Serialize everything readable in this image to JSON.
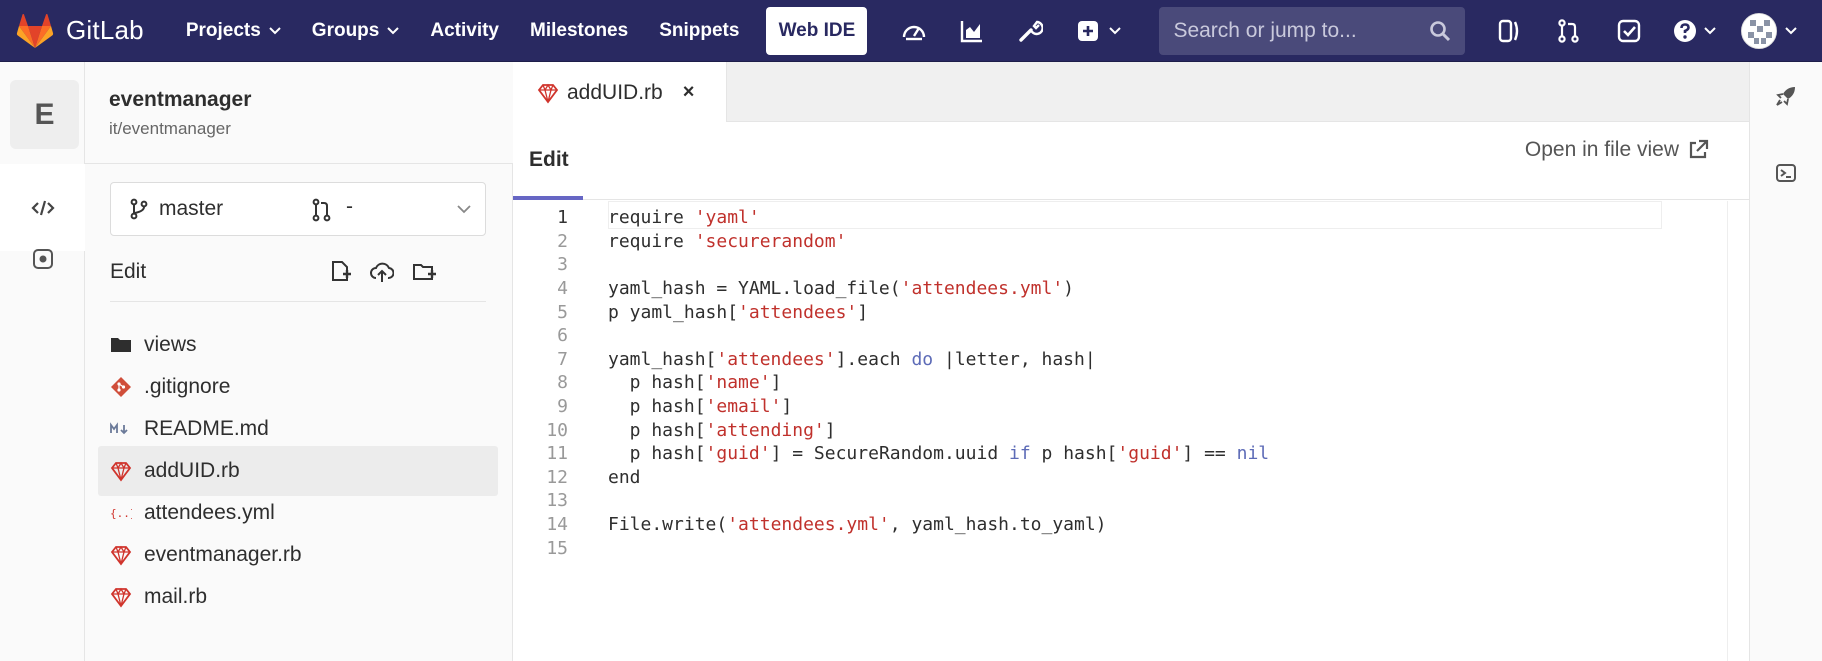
{
  "navbar": {
    "brand": "GitLab",
    "links": [
      "Projects",
      "Groups",
      "Activity",
      "Milestones",
      "Snippets"
    ],
    "web_ide_label": "Web IDE",
    "search_placeholder": "Search or jump to..."
  },
  "project": {
    "avatar_letter": "E",
    "name": "eventmanager",
    "path": "it/eventmanager"
  },
  "branch": {
    "name": "master",
    "merge_request": "-"
  },
  "tree": {
    "edit_label": "Edit",
    "files": [
      {
        "name": "views",
        "icon": "folder-icon"
      },
      {
        "name": ".gitignore",
        "icon": "git-icon"
      },
      {
        "name": "README.md",
        "icon": "markdown-icon"
      },
      {
        "name": "addUID.rb",
        "icon": "ruby-icon",
        "active": true
      },
      {
        "name": "attendees.yml",
        "icon": "yaml-icon"
      },
      {
        "name": "eventmanager.rb",
        "icon": "ruby-icon"
      },
      {
        "name": "mail.rb",
        "icon": "ruby-icon"
      }
    ]
  },
  "editor": {
    "tab_name": "addUID.rb",
    "tab_close": "×",
    "mode_tab": "Edit",
    "open_in_file_view": "Open in file view",
    "current_line": 1,
    "lines": [
      "require 'yaml'",
      "require 'securerandom'",
      "",
      "yaml_hash = YAML.load_file('attendees.yml')",
      "p yaml_hash['attendees']",
      "",
      "yaml_hash['attendees'].each do |letter, hash|",
      "  p hash['name']",
      "  p hash['email']",
      "  p hash['attending']",
      "  p hash['guid'] = SecureRandom.uuid if p hash['guid'] == nil",
      "end",
      "",
      "File.write('attendees.yml', yaml_hash.to_yaml)",
      ""
    ]
  },
  "colors": {
    "navbar": "#292961",
    "string": "#c0312c",
    "keyword": "#5d6bb7",
    "ruby_red": "#d0342c"
  }
}
